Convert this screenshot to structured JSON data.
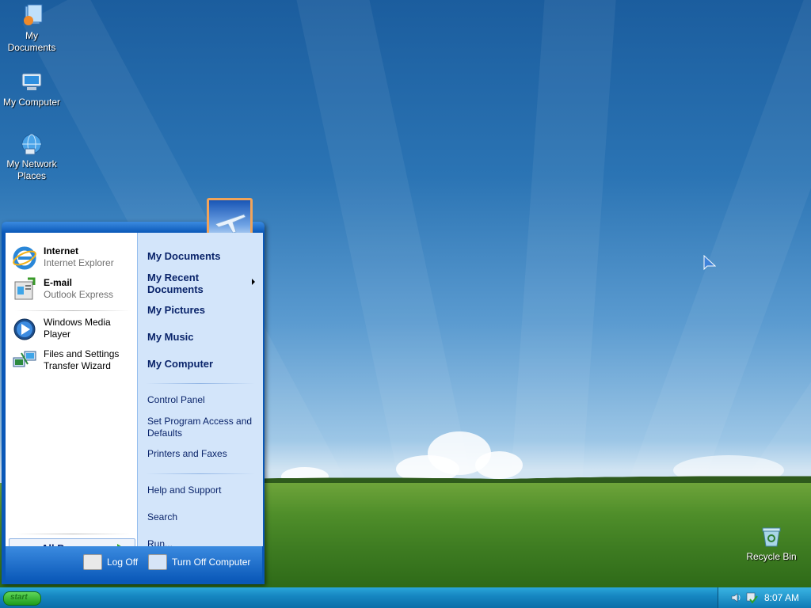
{
  "desktop": {
    "icons": [
      {
        "label": "My\nDocuments"
      },
      {
        "label": "My Computer"
      },
      {
        "label": "My Network\nPlaces"
      },
      {
        "label": "Recycle Bin"
      }
    ]
  },
  "start_menu": {
    "pinned": [
      {
        "title": "Internet",
        "subtitle": "Internet Explorer"
      },
      {
        "title": "E-mail",
        "subtitle": "Outlook Express"
      }
    ],
    "frequent": [
      {
        "label": "Windows Media Player"
      },
      {
        "label": "Files and Settings Transfer Wizard"
      }
    ],
    "all_programs": "All Programs",
    "places": [
      {
        "label": "My Documents"
      },
      {
        "label": "My Recent Documents"
      },
      {
        "label": "My Pictures"
      },
      {
        "label": "My Music"
      },
      {
        "label": "My Computer"
      }
    ],
    "system": [
      {
        "label": "Control Panel"
      },
      {
        "label": "Set Program Access and Defaults"
      },
      {
        "label": "Printers and Faxes"
      }
    ],
    "help": [
      {
        "label": "Help and Support"
      },
      {
        "label": "Search"
      },
      {
        "label": "Run..."
      }
    ],
    "log_off": "Log Off",
    "turn_off": "Turn Off Computer"
  },
  "taskbar": {
    "start_label": "start",
    "clock": "8:07 AM"
  }
}
